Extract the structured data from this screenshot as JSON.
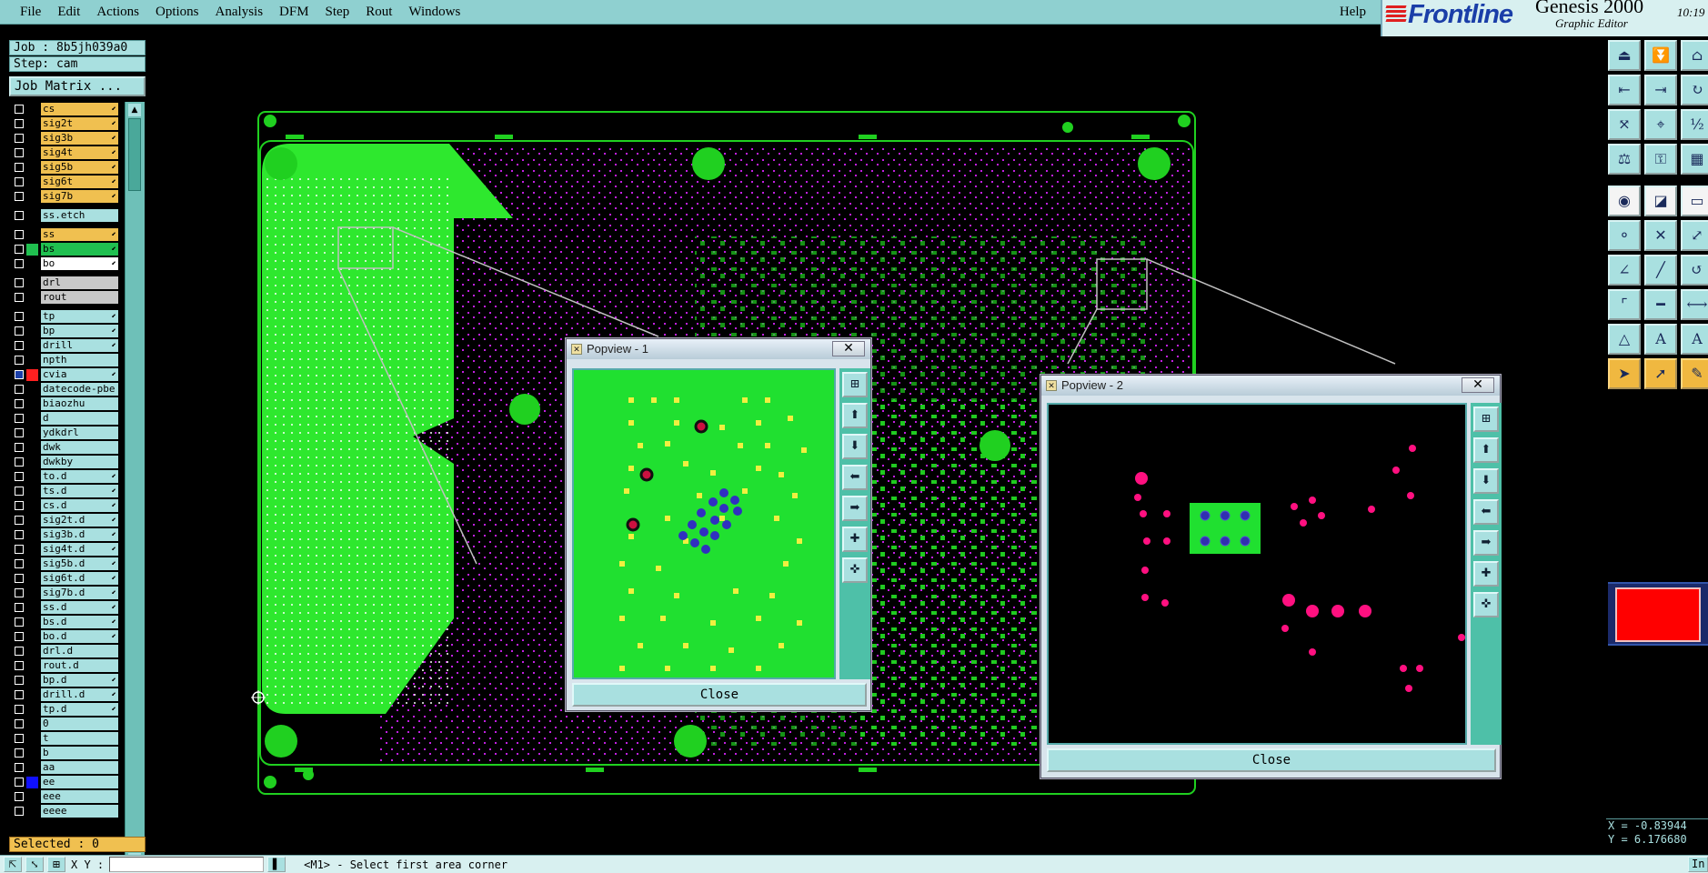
{
  "menu": {
    "items": [
      "File",
      "Edit",
      "Actions",
      "Options",
      "Analysis",
      "DFM",
      "Step",
      "Rout",
      "Windows"
    ],
    "help": "Help"
  },
  "brand": {
    "logo": "Frontline",
    "product": "Genesis 2000",
    "subtitle": "Graphic Editor",
    "clock_time": "10:19"
  },
  "job": {
    "job_label": "Job : 8b5jh039a0",
    "step_label": "Step: cam",
    "matrix_button": "Job Matrix ..."
  },
  "layers": [
    {
      "name": "cs",
      "color": "#f0c050",
      "arrow": true,
      "group": 1
    },
    {
      "name": "sig2t",
      "color": "#f0c050",
      "arrow": true,
      "group": 1
    },
    {
      "name": "sig3b",
      "color": "#f0c050",
      "arrow": true,
      "group": 1
    },
    {
      "name": "sig4t",
      "color": "#f0c050",
      "arrow": true,
      "group": 1
    },
    {
      "name": "sig5b",
      "color": "#f0c050",
      "arrow": true,
      "group": 1
    },
    {
      "name": "sig6t",
      "color": "#f0c050",
      "arrow": true,
      "group": 1
    },
    {
      "name": "sig7b",
      "color": "#f0c050",
      "arrow": true,
      "group": 1
    },
    {
      "name": "ss.etch",
      "color": "#a9e0e0",
      "arrow": false,
      "group": 2
    },
    {
      "name": "ss",
      "color": "#f0c050",
      "arrow": true,
      "group": 3
    },
    {
      "name": "bs",
      "color": "#20c050",
      "arrow": true,
      "group": 3,
      "swatch": "#20c050"
    },
    {
      "name": "bo",
      "color": "#ffffff",
      "arrow": true,
      "group": 3
    },
    {
      "name": "drl",
      "color": "#c8c8c8",
      "arrow": false,
      "group": 4
    },
    {
      "name": "rout",
      "color": "#c8c8c8",
      "arrow": false,
      "group": 4
    },
    {
      "name": "tp",
      "color": "#a9e0e0",
      "arrow": true,
      "group": 5
    },
    {
      "name": "bp",
      "color": "#a9e0e0",
      "arrow": true,
      "group": 5
    },
    {
      "name": "drill",
      "color": "#a9e0e0",
      "arrow": true,
      "group": 5
    },
    {
      "name": "npth",
      "color": "#a9e0e0",
      "arrow": false,
      "group": 5
    },
    {
      "name": "cvia",
      "color": "#a9e0e0",
      "arrow": true,
      "group": 5,
      "swatch": "#ff2020",
      "chk": "#1a3ea8"
    },
    {
      "name": "datecode-pbe",
      "color": "#a9e0e0",
      "arrow": false,
      "group": 5
    },
    {
      "name": "biaozhu",
      "color": "#a9e0e0",
      "arrow": false,
      "group": 5
    },
    {
      "name": "d",
      "color": "#a9e0e0",
      "arrow": false,
      "group": 5
    },
    {
      "name": "ydkdrl",
      "color": "#a9e0e0",
      "arrow": false,
      "group": 5
    },
    {
      "name": "dwk",
      "color": "#a9e0e0",
      "arrow": false,
      "group": 5
    },
    {
      "name": "dwkby",
      "color": "#a9e0e0",
      "arrow": false,
      "group": 5
    },
    {
      "name": "to.d",
      "color": "#a9e0e0",
      "arrow": true,
      "group": 5
    },
    {
      "name": "ts.d",
      "color": "#a9e0e0",
      "arrow": true,
      "group": 5
    },
    {
      "name": "cs.d",
      "color": "#a9e0e0",
      "arrow": true,
      "group": 5
    },
    {
      "name": "sig2t.d",
      "color": "#a9e0e0",
      "arrow": true,
      "group": 5
    },
    {
      "name": "sig3b.d",
      "color": "#a9e0e0",
      "arrow": true,
      "group": 5
    },
    {
      "name": "sig4t.d",
      "color": "#a9e0e0",
      "arrow": true,
      "group": 5
    },
    {
      "name": "sig5b.d",
      "color": "#a9e0e0",
      "arrow": true,
      "group": 5
    },
    {
      "name": "sig6t.d",
      "color": "#a9e0e0",
      "arrow": true,
      "group": 5
    },
    {
      "name": "sig7b.d",
      "color": "#a9e0e0",
      "arrow": true,
      "group": 5
    },
    {
      "name": "ss.d",
      "color": "#a9e0e0",
      "arrow": true,
      "group": 5
    },
    {
      "name": "bs.d",
      "color": "#a9e0e0",
      "arrow": true,
      "group": 5
    },
    {
      "name": "bo.d",
      "color": "#a9e0e0",
      "arrow": true,
      "group": 5
    },
    {
      "name": "drl.d",
      "color": "#a9e0e0",
      "arrow": false,
      "group": 5
    },
    {
      "name": "rout.d",
      "color": "#a9e0e0",
      "arrow": false,
      "group": 5
    },
    {
      "name": "bp.d",
      "color": "#a9e0e0",
      "arrow": true,
      "group": 5
    },
    {
      "name": "drill.d",
      "color": "#a9e0e0",
      "arrow": true,
      "group": 5
    },
    {
      "name": "tp.d",
      "color": "#a9e0e0",
      "arrow": true,
      "group": 5
    },
    {
      "name": "0",
      "color": "#a9e0e0",
      "arrow": false,
      "group": 5
    },
    {
      "name": "t",
      "color": "#a9e0e0",
      "arrow": false,
      "group": 5
    },
    {
      "name": "b",
      "color": "#a9e0e0",
      "arrow": false,
      "group": 5
    },
    {
      "name": "aa",
      "color": "#a9e0e0",
      "arrow": false,
      "group": 5
    },
    {
      "name": "ee",
      "color": "#a9e0e0",
      "arrow": false,
      "group": 5,
      "swatch": "#1010ff"
    },
    {
      "name": "eee",
      "color": "#a9e0e0",
      "arrow": false,
      "group": 5
    },
    {
      "name": "eeee",
      "color": "#a9e0e0",
      "arrow": false,
      "group": 5
    }
  ],
  "selected_label": "Selected : 0",
  "popview1": {
    "title": "Popview - 1",
    "close_label": "Close"
  },
  "popview2": {
    "title": "Popview - 2",
    "close_label": "Close"
  },
  "coords": {
    "x": "X = -0.83944",
    "y": "Y = 6.176680"
  },
  "status": {
    "xy_label": "X Y :",
    "xy_value": "",
    "message": "<M1> - Select first area corner",
    "right_label": "In"
  },
  "colors": {
    "board_green": "#2ee82e",
    "copper": "#20d020",
    "via_magenta": "#c020e0",
    "panel_cyan": "#a9e0e0",
    "menu_bg": "#8fd0d0"
  }
}
